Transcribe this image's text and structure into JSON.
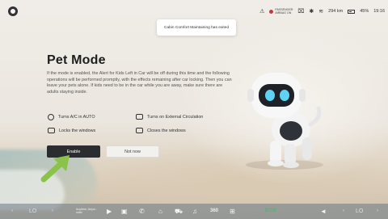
{
  "status_bar": {
    "passenger_airbag": "PASSENGER AIRBAG ON",
    "range": "294 km",
    "battery": "45%",
    "time": "19:16"
  },
  "toast": {
    "text": "Cabin Comfort Maintaining has exited"
  },
  "pet_mode": {
    "title": "Pet Mode",
    "description": "If the mode is enabled, the Alert for Kids Left in Car will be off during this time and the following operations will be performed promptly, with the effects remaining after car locking. Then you can leave your pets alone. If kids need to be in the car while you are away, make sure there are adults staying inside.",
    "features": [
      {
        "icon": "ac-icon",
        "label": "Turns A/C in AUTO"
      },
      {
        "icon": "circulation-icon",
        "label": "Turns on External Circulation"
      },
      {
        "icon": "window-lock-icon",
        "label": "Locks the windows"
      },
      {
        "icon": "window-close-icon",
        "label": "Closes the windows"
      }
    ],
    "enable_label": "Enable",
    "not_now_label": "Not now"
  },
  "dock": {
    "temp_left": "LO",
    "temp_right": "LO",
    "media_title": "Anytime, Anyw...",
    "media_artist": "milet",
    "eco_label": "ECO",
    "view_360": "360"
  },
  "colors": {
    "primary_button": "#2a2c30",
    "arrow": "#8bc34a",
    "eco": "#3fbf5a"
  }
}
